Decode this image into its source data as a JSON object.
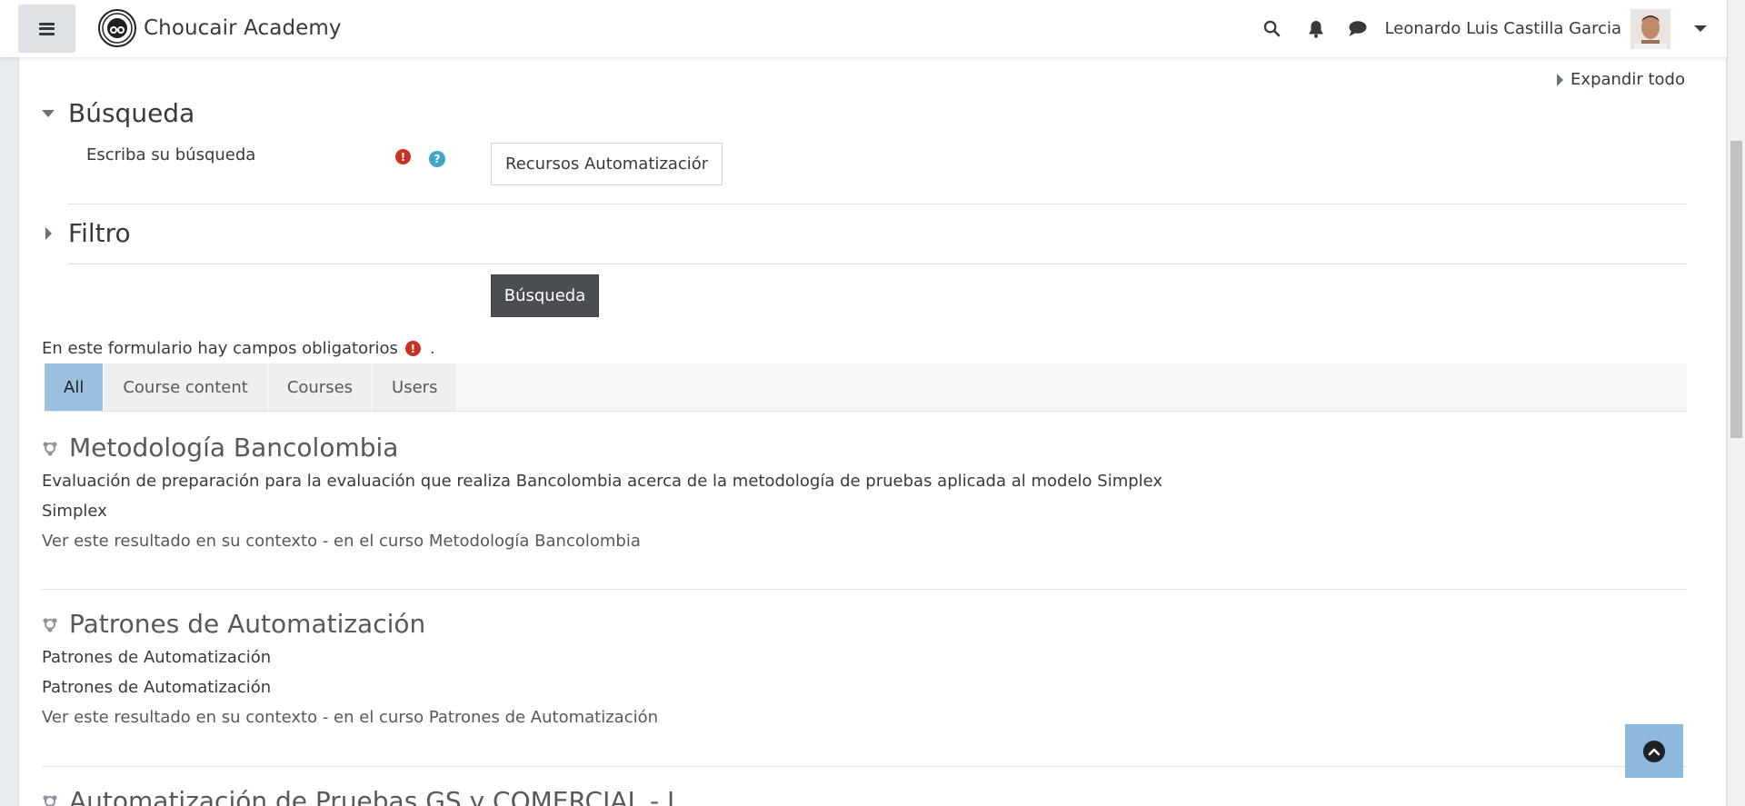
{
  "navbar": {
    "brand": "Choucair Academy",
    "user_name": "Leonardo Luis Castilla Garcia",
    "icons": [
      "menu-icon",
      "search-icon",
      "bell-icon",
      "chat-icon",
      "chevron-down-icon"
    ]
  },
  "form": {
    "expand_all": "Expandir todo",
    "search_section_title": "Búsqueda",
    "search_label": "Escriba su búsqueda",
    "search_value": "Recursos Automatización",
    "filter_section_title": "Filtro",
    "submit_label": "Búsqueda",
    "required_note": "En este formulario hay campos obligatorios",
    "required_note_end": "."
  },
  "tabs": [
    {
      "label": "All",
      "active": true
    },
    {
      "label": "Course content",
      "active": false
    },
    {
      "label": "Courses",
      "active": false
    },
    {
      "label": "Users",
      "active": false
    }
  ],
  "results": [
    {
      "title": "Metodología Bancolombia",
      "lines": [
        "Evaluación de preparación para la evaluación que realiza Bancolombia acerca de la metodología de pruebas aplicada al modelo Simplex",
        "Simplex"
      ],
      "context": "Ver este resultado en su contexto - en el curso Metodología Bancolombia"
    },
    {
      "title": "Patrones de Automatización",
      "lines": [
        "Patrones de Automatización",
        "Patrones de Automatización"
      ],
      "context": "Ver este resultado en su contexto - en el curso Patrones de Automatización"
    },
    {
      "title": "Automatización de Pruebas GS y COMERCIAL - I",
      "lines": [],
      "context": ""
    }
  ],
  "colors": {
    "required": "#ca3120",
    "help": "#3fa7c9",
    "tab_active": "#9bbfdf",
    "button_dark": "#4a4d52",
    "back_to_top": "#8fb8dd"
  }
}
